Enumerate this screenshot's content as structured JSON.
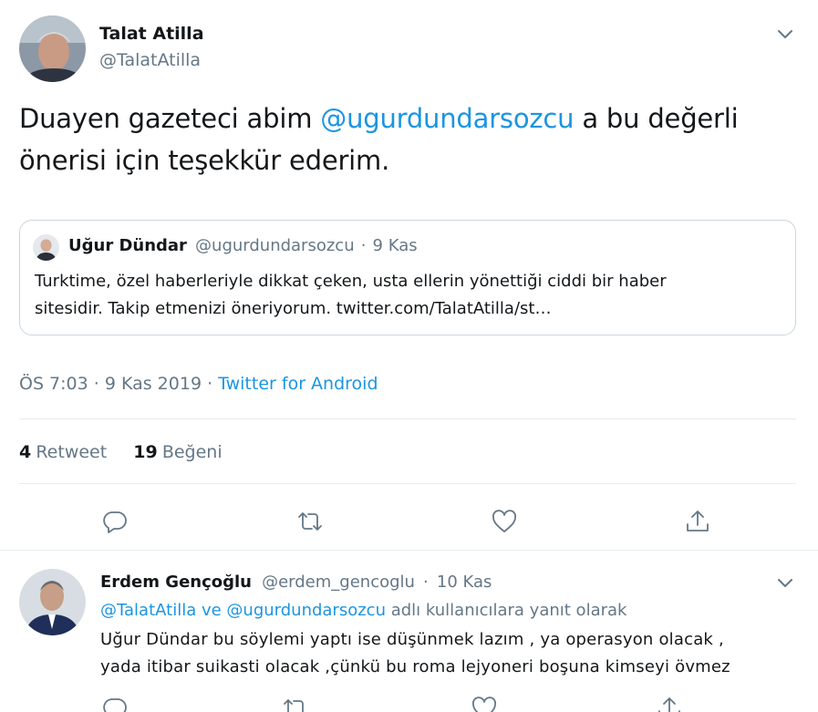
{
  "main_tweet": {
    "author": {
      "name": "Talat Atilla",
      "handle": "@TalatAtilla"
    },
    "text_part1": "Duayen gazeteci abim ",
    "mention": "@ugurdundarsozcu",
    "text_part2": " a bu değerli",
    "text_line2": "önerisi için teşekkür ederim.",
    "quoted": {
      "name": "Uğur Dündar",
      "handle": "@ugurdundarsozcu",
      "separator": "·",
      "date": "9 Kas",
      "line1": "Turktime, özel haberleriyle dikkat çeken, usta ellerin yönettiği ciddi bir haber",
      "line2": "sitesidir. Takip etmenizi öneriyorum. twitter.com/TalatAtilla/st…"
    },
    "timestamp": "ÖS 7:03 · 9 Kas 2019 · ",
    "source": "Twitter for Android",
    "stats": {
      "retweet_count": "4",
      "retweet_label": "Retweet",
      "like_count": "19",
      "like_label": "Beğeni"
    },
    "actions": [
      "reply-icon",
      "retweet-icon",
      "like-icon",
      "share-icon"
    ]
  },
  "reply": {
    "author": {
      "name": "Erdem Gençoğlu",
      "handle": "@erdem_gencoglu"
    },
    "separator": "·",
    "date": "10 Kas",
    "reply_to_user1": "@TalatAtilla",
    "reply_to_and": " ve ",
    "reply_to_user2": "@ugurdundarsozcu",
    "reply_to_suffix": " adlı kullanıcılara yanıt olarak",
    "line1": "Uğur Dündar bu söylemi yaptı ise düşünmek lazım , ya operasyon olacak ,",
    "line2": "yada itibar suikasti olacak ,çünkü bu roma lejyoneri boşuna kimseyi övmez"
  },
  "colors": {
    "link": "#1b95e0",
    "muted": "#657786",
    "border": "#ccd6dd",
    "divider": "#e6ecf0"
  }
}
